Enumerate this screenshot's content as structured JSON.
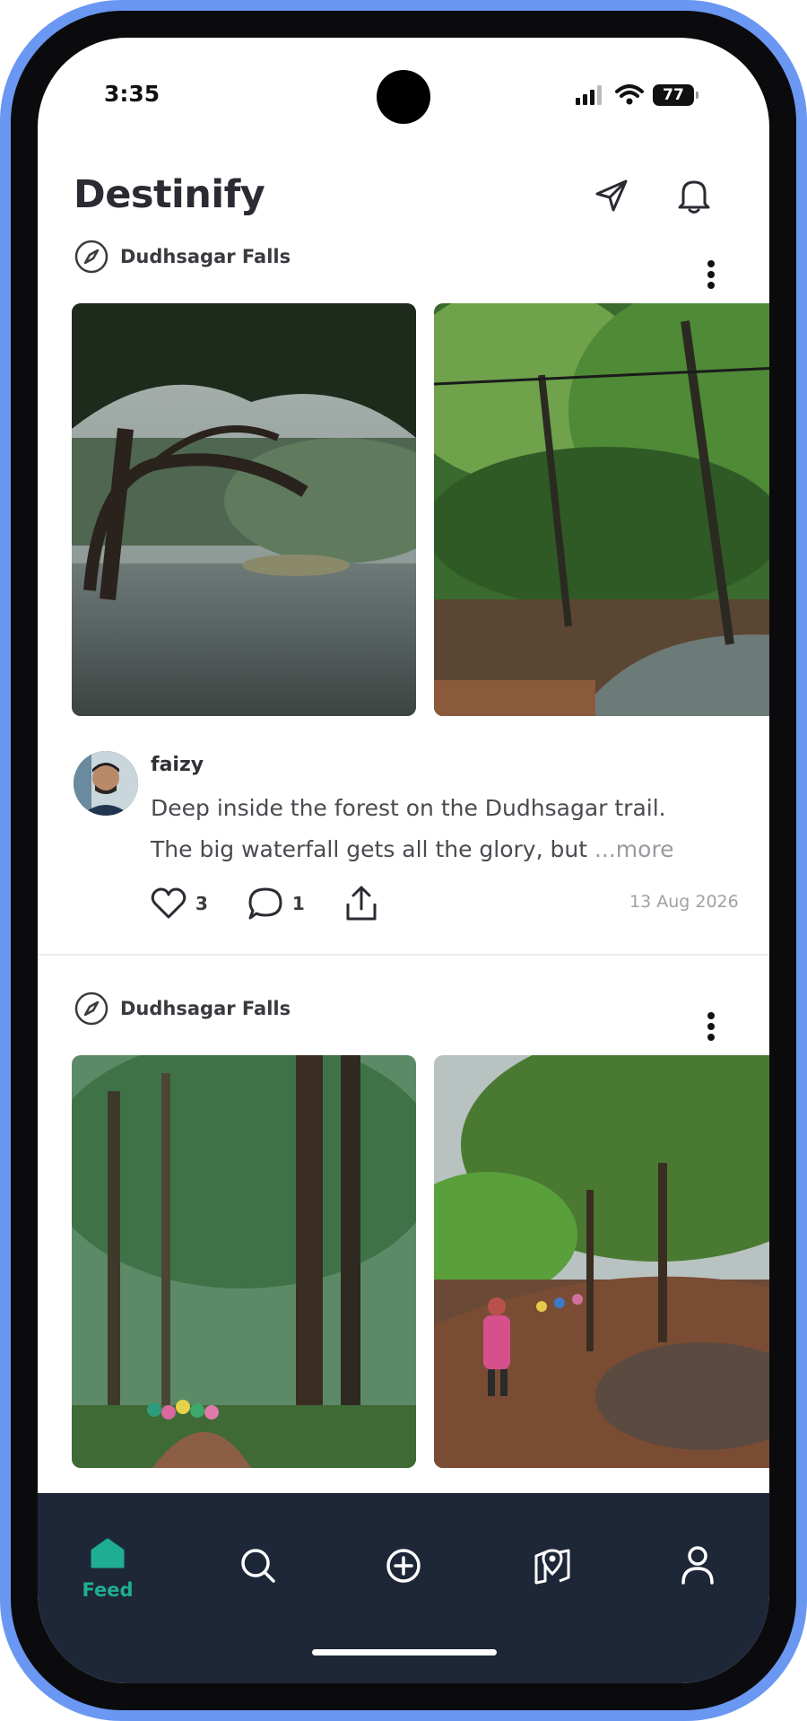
{
  "status_bar": {
    "time": "3:35",
    "battery": "77"
  },
  "header": {
    "title": "Destinify",
    "send_icon": "send-icon",
    "bell_icon": "bell-icon"
  },
  "posts": [
    {
      "location": "Dudhsagar Falls",
      "photos": [
        "forest river with overhanging branches",
        "green forest stream"
      ],
      "author": "faizy",
      "caption_line1": "Deep inside the forest on the Dudhsagar trail.",
      "caption_line2": "The big waterfall gets all the glory, but ",
      "more_label": "...more",
      "likes": "3",
      "comments": "1",
      "date": "13 Aug 2026"
    },
    {
      "location": "Dudhsagar Falls",
      "photos": [
        "misty forest trail with hikers",
        "hikers on muddy trail"
      ]
    }
  ],
  "nav": {
    "items": [
      {
        "label": "Feed",
        "icon": "home-icon",
        "active": true
      },
      {
        "label": "",
        "icon": "search-icon"
      },
      {
        "label": "",
        "icon": "add-icon"
      },
      {
        "label": "",
        "icon": "map-pin-icon"
      },
      {
        "label": "",
        "icon": "profile-icon"
      }
    ]
  },
  "colors": {
    "frame": "#6a97f2",
    "nav_bg": "#1e2738",
    "accent": "#1fae93",
    "text": "#2b2b33"
  }
}
